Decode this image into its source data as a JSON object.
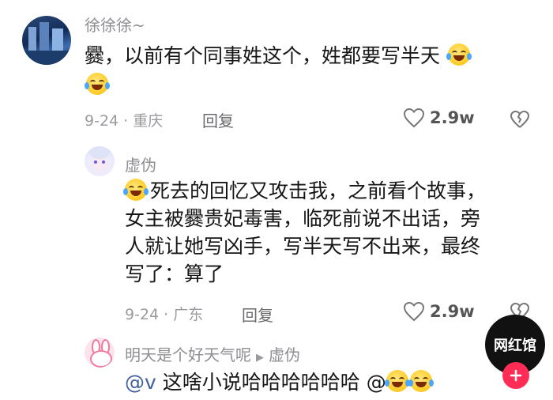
{
  "comments": [
    {
      "author": "徐徐徐~",
      "text": "爨，以前有个同事姓这个，姓都要写半天",
      "emojis": [
        "laugh-cry-emoji",
        "laugh-cry-emoji"
      ],
      "date_location": "9-24 · 重庆",
      "reply_label": "回复",
      "likes": "2.9w"
    },
    {
      "author": "虚伪",
      "lines": [
        "死去的回忆又攻击我，之前看个故事，",
        "女主被爨贵妃毒害，临死前说不出话，旁",
        "人就让她写凶手，写半天写不出来，最终",
        "写了：算了"
      ],
      "date_location": "9-24 · 广东",
      "reply_label": "回复",
      "likes": "2.9w"
    },
    {
      "author": "明天是个好天气呢",
      "reply_to": "虚伪",
      "mention": "@v",
      "text": "这啥小说哈哈哈哈哈哈",
      "trailing_at": "@"
    }
  ],
  "watermark": {
    "text": "网红馆"
  },
  "fab": {
    "icon": "plus-icon"
  },
  "colors": {
    "accent": "#ff2d55",
    "badge_bg": "#111111"
  }
}
